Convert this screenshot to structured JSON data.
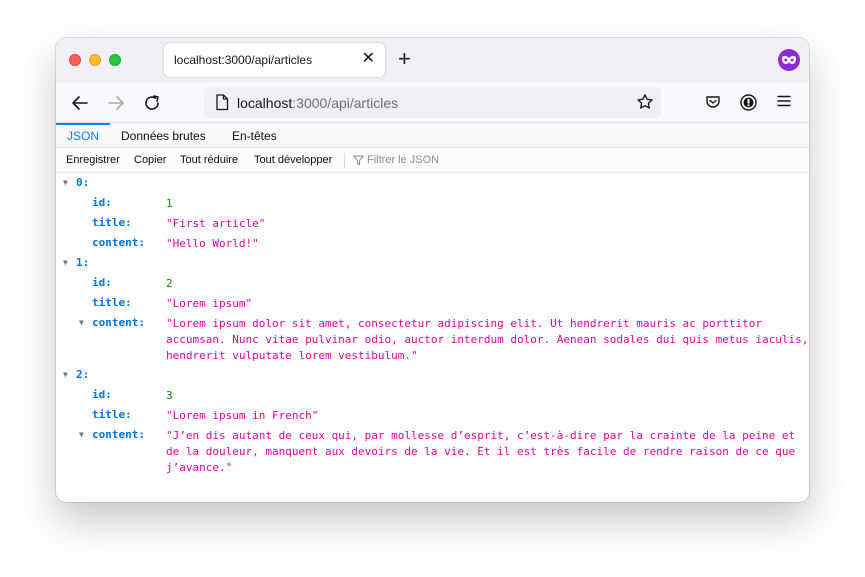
{
  "tab": {
    "title": "localhost:3000/api/articles",
    "close": "✕",
    "new": "+"
  },
  "url": {
    "host": "localhost",
    "path": ":3000/api/articles"
  },
  "viewer_tabs": [
    "JSON",
    "Données brutes",
    "En-têtes"
  ],
  "toolbar": {
    "save": "Enregistrer",
    "copy": "Copier",
    "collapse": "Tout réduire",
    "expand": "Tout développer",
    "filter_placeholder": "Filtrer le JSON"
  },
  "colors": {
    "key": "#0074e8",
    "string": "#dd00a9",
    "number": "#058b00",
    "accent": "#0a84ff"
  },
  "json": [
    {
      "index": "0:",
      "fields": [
        {
          "key": "id:",
          "value": "1",
          "type": "num"
        },
        {
          "key": "title:",
          "value": "\"First article\"",
          "type": "str"
        },
        {
          "key": "content:",
          "value": "\"Hello World!\"",
          "type": "str"
        }
      ]
    },
    {
      "index": "1:",
      "fields": [
        {
          "key": "id:",
          "value": "2",
          "type": "num"
        },
        {
          "key": "title:",
          "value": "\"Lorem ipsum\"",
          "type": "str"
        },
        {
          "key": "content:",
          "value": "\"Lorem ipsum dolor sit amet, consectetur adipiscing elit. Ut hendrerit mauris ac porttitor\naccumsan. Nunc vitae pulvinar odio, auctor interdum dolor. Aenean sodales dui quis metus iaculis,\nhendrerit vulputate lorem vestibulum.\"",
          "type": "str"
        }
      ]
    },
    {
      "index": "2:",
      "fields": [
        {
          "key": "id:",
          "value": "3",
          "type": "num"
        },
        {
          "key": "title:",
          "value": "\"Lorem ipsum in French\"",
          "type": "str"
        },
        {
          "key": "content:",
          "value": "\"J’en dis autant de ceux qui, par mollesse d’esprit, c’est-à-dire par la crainte de la peine et\nde la douleur, manquent aux devoirs de la vie. Et il est très facile de rendre raison de ce que\nj’avance.\"",
          "type": "str"
        }
      ]
    }
  ]
}
